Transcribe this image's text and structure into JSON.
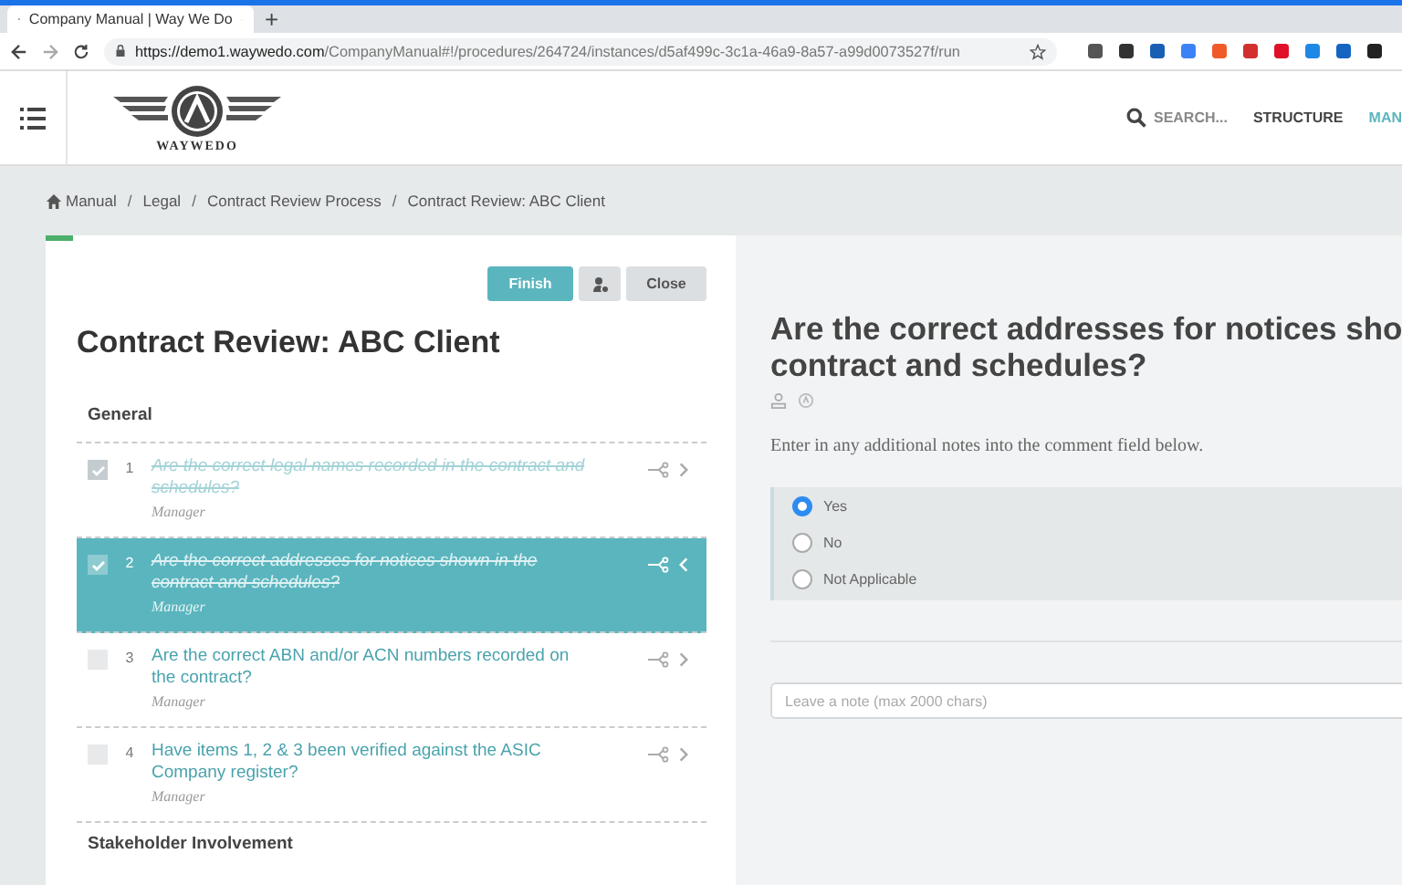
{
  "browser": {
    "tab_title": "Company Manual | Way We Do",
    "new_tab": "+",
    "url_host": "https://demo1.waywedo.com",
    "url_path": "/CompanyManual#!/procedures/264724/instances/d5af499c-3c1a-46a9-8a57-a99d0073527f/run"
  },
  "header": {
    "logo_text": "WAYWEDO",
    "search": "SEARCH...",
    "nav": [
      {
        "label": "STRUCTURE",
        "selected": false
      },
      {
        "label": "MAN",
        "selected": true
      }
    ]
  },
  "breadcrumb_separator": "/",
  "breadcrumb": [
    "Manual",
    "Legal",
    "Contract Review Process",
    "Contract Review: ABC Client"
  ],
  "checklist": {
    "title": "Contract Review: ABC Client",
    "buttons": {
      "finish": "Finish",
      "close": "Close"
    },
    "section": "General",
    "items": [
      {
        "number": "1",
        "text": "Are the correct legal names recorded in the contract and schedules?",
        "role": "Manager",
        "checked": true,
        "selected": false
      },
      {
        "number": "2",
        "text": "Are the correct addresses for notices shown in the contract and schedules?",
        "role": "Manager",
        "checked": true,
        "selected": true
      },
      {
        "number": "3",
        "text": "Are the correct ABN and/or ACN numbers recorded on the contract?",
        "role": "Manager",
        "checked": false,
        "selected": false
      },
      {
        "number": "4",
        "text": "Have items 1, 2 & 3 been verified against the ASIC Company register?",
        "role": "Manager",
        "checked": false,
        "selected": false
      }
    ],
    "next_section": "Stakeholder Involvement"
  },
  "detail": {
    "title_lines": [
      "Are the correct addresses for notices sho",
      "contract and schedules?"
    ],
    "description": "Enter in any additional notes into the comment field below.",
    "options": [
      {
        "label": "Yes",
        "selected": true
      },
      {
        "label": "No",
        "selected": false
      },
      {
        "label": "Not Applicable",
        "selected": false
      }
    ],
    "note": {
      "placeholder": "Leave a note (max 2000 chars)"
    }
  }
}
